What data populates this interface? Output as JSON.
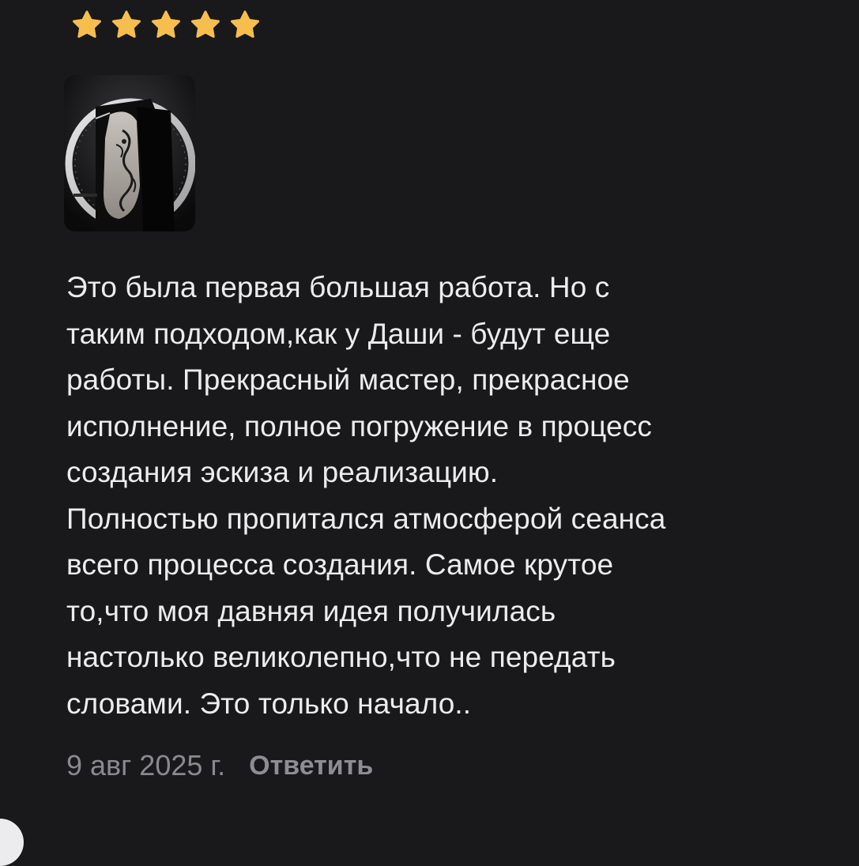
{
  "review": {
    "rating": 5,
    "rating_max": 5,
    "star_color": "#f6be4f",
    "photo": {
      "icon": "tattoo-photo-thumbnail"
    },
    "text": "Это была первая большая работа. Но с\nтаким подходом,как у Даши - будут еще\nработы. Прекрасный мастер, прекрасное\nисполнение, полное погружение в процесс\nсоздания эскиза и реализацию.\nПолностью пропитался атмосферой сеанса\nвсего процесса создания. Самое крутое\nто,что моя давняя идея получилась\nнастолько великолепно,что не передать\nсловами. Это только начало..",
    "date": "9 авг 2025 г.",
    "reply_label": "Ответить"
  },
  "colors": {
    "background": "#19191b",
    "text": "#ececee",
    "muted": "#8a8a8e"
  }
}
